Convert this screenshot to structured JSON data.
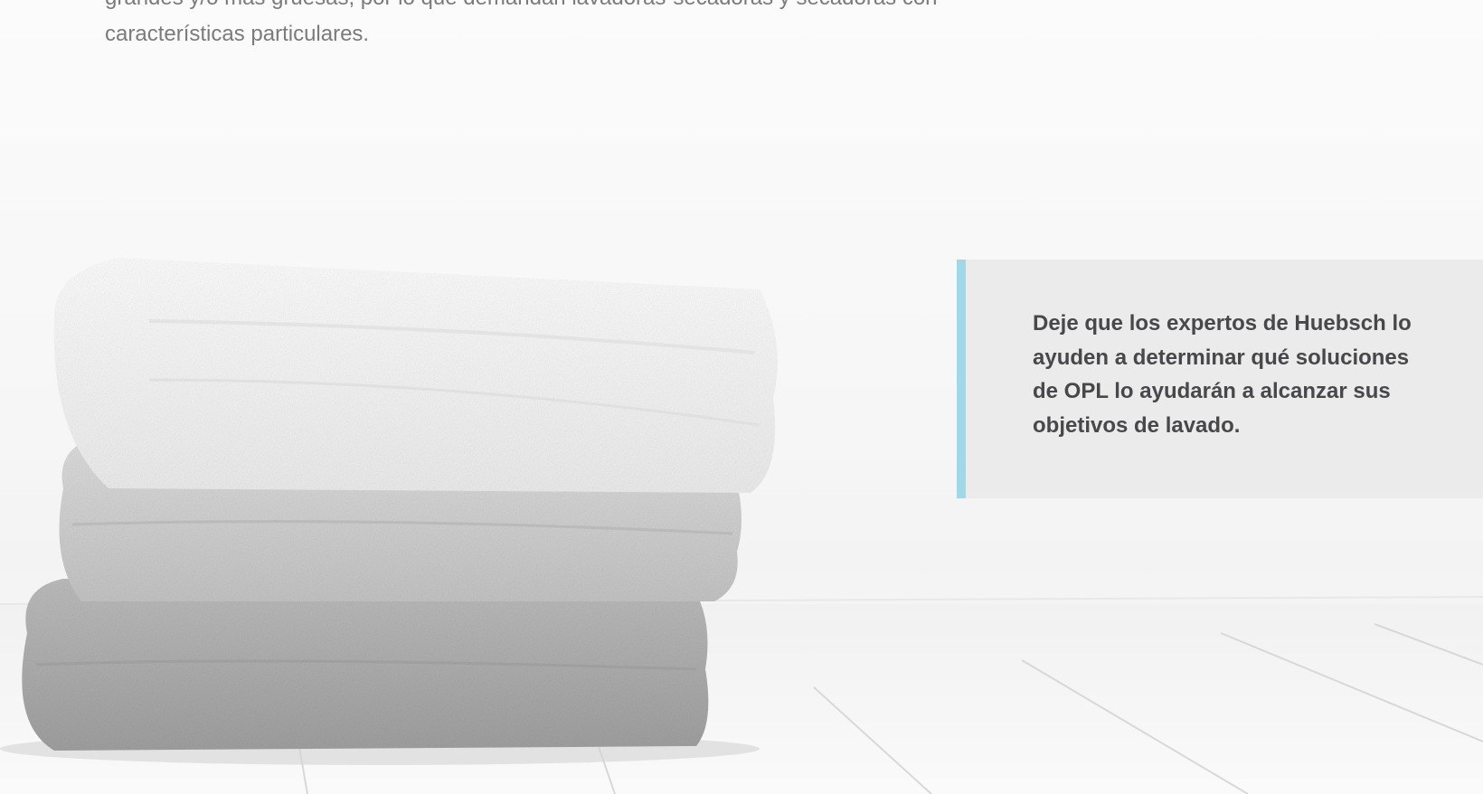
{
  "intro": {
    "text": "grandes y/o más gruesas, por lo que demandan lavadoras-secadoras y secadoras con características particulares."
  },
  "hero_image": {
    "subject": "stack-of-towels-photo"
  },
  "callout": {
    "text": "Deje que los expertos de Huebsch lo ayuden a determinar qué soluciones de OPL lo ayudarán a alcanzar sus objetivos de lavado.",
    "accent_color": "#9fd8e6",
    "background_color": "#ebebeb"
  }
}
